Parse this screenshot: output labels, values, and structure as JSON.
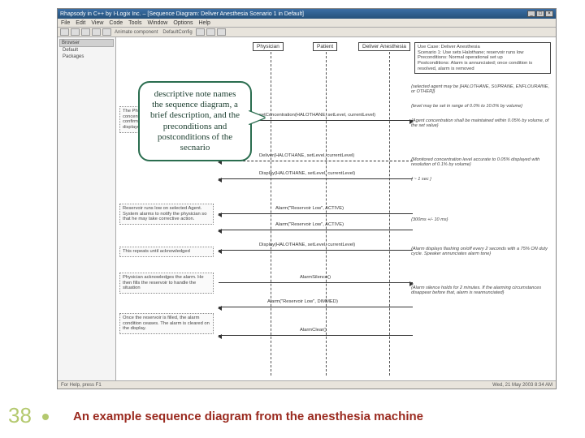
{
  "slide": {
    "number": "38",
    "caption": "An example sequence diagram from the anesthesia machine"
  },
  "callout": {
    "text": "descriptive note names the sequence diagram, a brief description, and the preconditions and postconditions of the secnario"
  },
  "ide": {
    "title": "Rhapsody in C++ by I-Logix Inc. – [Sequence Diagram: Deliver Anesthesia Scenario 1 in Default]",
    "menus": [
      "File",
      "Edit",
      "View",
      "Code",
      "Tools",
      "Window",
      "Options",
      "Help"
    ],
    "toolbar_combos": [
      "Animate component",
      "DefaultConfig"
    ],
    "browser": {
      "header": "Browser",
      "items": [
        "Default",
        "Packages"
      ]
    },
    "statusbar_left": "For Help, press F1",
    "statusbar_right": "Wed, 21 May 2003  8:34 AM"
  },
  "lifelines": {
    "physician": "Physician",
    "patient": "Patient",
    "deliver": "Deliver Anesthesia"
  },
  "sidenotes": [
    "The Physician enters the desired concentration, the system validates and confirms the request, and updates the displayed monitored value periodically",
    "Reservoir runs low on selected Agent. System alarms to notify the physician so that he may take corrective action.",
    "This repeats until acknowledged",
    "Physician acknowledges the alarm. He then fills the reservoir to handle the situation",
    "Once the reservoir is filled, the alarm condition ceases. The alarm is cleared on the display."
  ],
  "usecase_note": {
    "line1": "Use Case: Deliver Anesthesia",
    "line2": "Scenario 1: Use sets Halothane; reservoir runs low",
    "line3": "Preconditions: Normal operational set up",
    "line4": "Postconditions: Alarm is annunciated; once condition is resolved, alarm is removed"
  },
  "right_annotations": [
    "{selected agent may be [HALOTHANE, SUPRANE, ENFLOURAINE, or OTHER]}",
    "{level may be set in range of 0.0% to 10.0% by volume}",
    "{Agent concentration shall be maintained within 0.05% by volume, of the set value}",
    "{Monitored concentration level accurate to 0.05% displayed with resolution of 0.1% by volume}",
    "{ ~ 1 sec }",
    "{300ms +/- 10 ms}",
    "{Alarm displays flashing on/off every 2 seconds with a 75% ON duty cycle. Speaker annunciates alarm tone}",
    "{Alarm silence holds for 2 minutes. If the alarming circumstances disappear before that, alarm is reannunciated}"
  ],
  "messages": [
    "setConcentration(HALOTHANE, setLevel, currentLevel)",
    "Deliver(HALOTHANE, setLevel, currentLevel)",
    "Display(HALOTHANE, setLevel, currentLevel)",
    "Alarm(\"Reservoir Low\", ACTIVE)",
    "Alarm(\"Reservoir Low\", ACTIVE)",
    "Display(HALOTHANE, setLevel, currentLevel)",
    "AlarmSilence()",
    "Alarm(\"Reservoir Low\", DIMMED)",
    "AlarmClear()"
  ]
}
